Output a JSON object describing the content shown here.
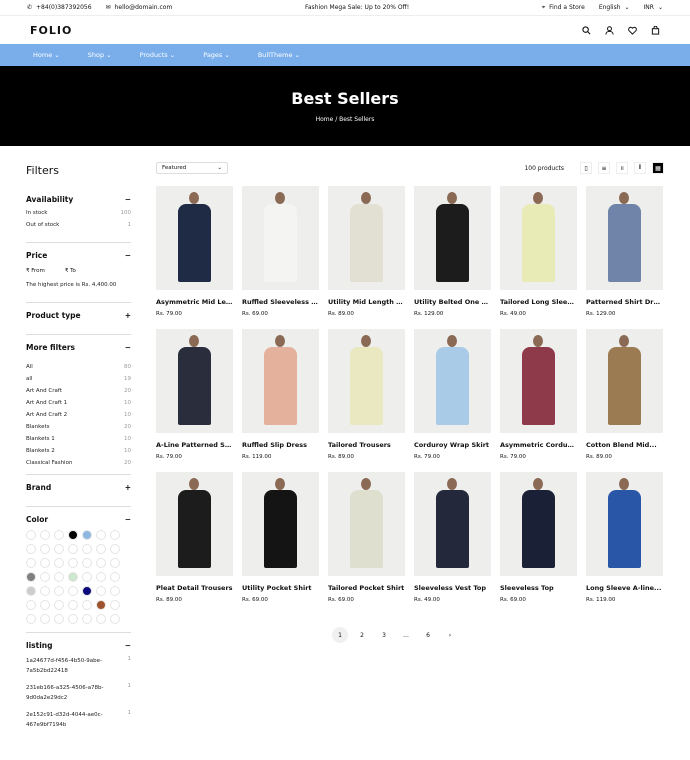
{
  "topbar": {
    "phone": "+84(0)387392056",
    "email": "hello@domain.com",
    "promo": "Fashion Mega Sale: Up to 20% Off!",
    "store": "Find a Store",
    "language": "English",
    "currency": "INR"
  },
  "header": {
    "logo": "FOLIO"
  },
  "nav": [
    "Home",
    "Shop",
    "Products",
    "Pages",
    "BullTheme"
  ],
  "hero": {
    "title": "Best Sellers",
    "breadcrumb": "Home  /  Best Sellers"
  },
  "filters": {
    "title": "Filters",
    "availability": {
      "label": "Availability",
      "items": [
        {
          "label": "In stock",
          "count": "100"
        },
        {
          "label": "Out of stock",
          "count": "1"
        }
      ]
    },
    "price": {
      "label": "Price",
      "from": "₹  From",
      "to": "₹  To",
      "note": "The highest price is Rs. 4,400.00"
    },
    "product_type": "Product type",
    "more": {
      "label": "More filters",
      "items": [
        {
          "label": "All",
          "count": "80"
        },
        {
          "label": "all",
          "count": "19"
        },
        {
          "label": "Art And Craft",
          "count": "20"
        },
        {
          "label": "Art And Craft 1",
          "count": "10"
        },
        {
          "label": "Art And Craft 2",
          "count": "10"
        },
        {
          "label": "Blankets",
          "count": "20"
        },
        {
          "label": "Blankets 1",
          "count": "10"
        },
        {
          "label": "Blankets 2",
          "count": "10"
        },
        {
          "label": "Classical Fashion",
          "count": "20"
        }
      ]
    },
    "brand": "Brand",
    "color": {
      "label": "Color",
      "swatches": [
        "#ffffff",
        "#ffffff",
        "#ffffff",
        "#000000",
        "#8fb6e0",
        "#ffffff",
        "#ffffff",
        "#ffffff",
        "#ffffff",
        "#ffffff",
        "#ffffff",
        "#ffffff",
        "#ffffff",
        "#ffffff",
        "#ffffff",
        "#ffffff",
        "#ffffff",
        "#ffffff",
        "#ffffff",
        "#ffffff",
        "#ffffff",
        "#808080",
        "#ffffff",
        "#ffffff",
        "#cfe6cf",
        "#ffffff",
        "#ffffff",
        "#ffffff",
        "#cccccc",
        "#ffffff",
        "#ffffff",
        "#ffffff",
        "#0a0a7a",
        "#ffffff",
        "#ffffff",
        "#ffffff",
        "#ffffff",
        "#ffffff",
        "#ffffff",
        "#ffffff",
        "#a0522d",
        "#ffffff",
        "#ffffff",
        "#ffffff",
        "#ffffff",
        "#ffffff",
        "#ffffff",
        "#ffffff",
        "#ffffff"
      ]
    },
    "listing": {
      "label": "listing",
      "items": [
        {
          "label": "1a24677d-f456-4b50-9abe-7a5b2bd22418",
          "count": "1"
        },
        {
          "label": "231eb166-a325-4506-a78b-9d0da2e29dc2",
          "count": "1"
        },
        {
          "label": "2e152c91-d32d-4044-ae0c-467e9bf7194b",
          "count": "1"
        }
      ]
    }
  },
  "toolbar": {
    "sort": "Featured",
    "count": "100 products"
  },
  "products": [
    {
      "name": "Asymmetric Mid Length...",
      "price": "Rs. 79.00",
      "color": "#1f2a45"
    },
    {
      "name": "Ruffled Sleeveless Top",
      "price": "Rs. 69.00",
      "color": "#f4f4f2"
    },
    {
      "name": "Utility Mid Length Skirt",
      "price": "Rs. 89.00",
      "color": "#e2e0d2"
    },
    {
      "name": "Utility Belted One Piece",
      "price": "Rs. 129.00",
      "color": "#1c1c1c"
    },
    {
      "name": "Tailored Long Sleeve...",
      "price": "Rs. 49.00",
      "color": "#e9ebb7"
    },
    {
      "name": "Patterned Shirt Dress",
      "price": "Rs. 129.00",
      "color": "#6f84a8"
    },
    {
      "name": "A-Line Patterned Slip...",
      "price": "Rs. 79.00",
      "color": "#2a2e3c"
    },
    {
      "name": "Ruffled Slip Dress",
      "price": "Rs. 119.00",
      "color": "#e4b19c"
    },
    {
      "name": "Tailored Trousers",
      "price": "Rs. 89.00",
      "color": "#e9e8c0"
    },
    {
      "name": "Corduroy Wrap Skirt",
      "price": "Rs. 79.00",
      "color": "#a9cbe8"
    },
    {
      "name": "Asymmetric Corduroy...",
      "price": "Rs. 79.00",
      "color": "#8f3a4a"
    },
    {
      "name": "Cotton Blend Mid...",
      "price": "Rs. 89.00",
      "color": "#9b7b52"
    },
    {
      "name": "Pleat Detail Trousers",
      "price": "Rs. 89.00",
      "color": "#1c1c1c"
    },
    {
      "name": "Utility Pocket Shirt",
      "price": "Rs. 69.00",
      "color": "#141414"
    },
    {
      "name": "Tailored Pocket Shirt",
      "price": "Rs. 69.00",
      "color": "#dedfcf"
    },
    {
      "name": "Sleeveless Vest Top",
      "price": "Rs. 49.00",
      "color": "#23283a"
    },
    {
      "name": "Sleeveless Top",
      "price": "Rs. 69.00",
      "color": "#1a2136"
    },
    {
      "name": "Long Sleeve A-line...",
      "price": "Rs. 119.00",
      "color": "#2a56a8"
    }
  ],
  "pagination": [
    "1",
    "2",
    "3",
    "...",
    "6",
    "›"
  ]
}
